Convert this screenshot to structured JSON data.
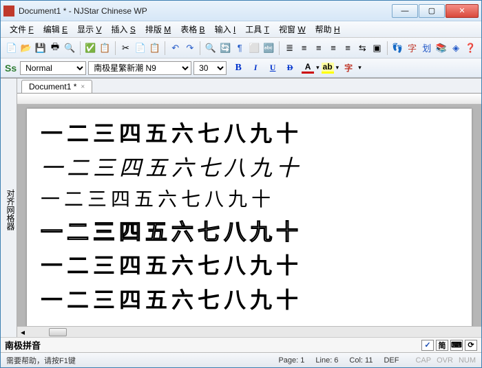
{
  "window": {
    "title": "Document1 * - NJStar Chinese WP"
  },
  "menu": {
    "items": [
      {
        "label": "文件",
        "key": "F"
      },
      {
        "label": "编辑",
        "key": "E"
      },
      {
        "label": "显示",
        "key": "V"
      },
      {
        "label": "插入",
        "key": "S"
      },
      {
        "label": "排版",
        "key": "M"
      },
      {
        "label": "表格",
        "key": "B"
      },
      {
        "label": "输入",
        "key": "I"
      },
      {
        "label": "工具",
        "key": "T"
      },
      {
        "label": "视窗",
        "key": "W"
      },
      {
        "label": "帮助",
        "key": "H"
      }
    ]
  },
  "toolbar1": {
    "icons": [
      "📄",
      "📂",
      "💾",
      "🖶",
      "🔍",
      "✅",
      "📋",
      "✂",
      "📄",
      "📋",
      "↶",
      "↷",
      "🔍",
      "🔄",
      "¶",
      "⬜",
      "🔤",
      "≣",
      "≡",
      "≡",
      "≡",
      "≡",
      "⇆",
      "▣",
      "👣",
      "字",
      "划",
      "📚",
      "◈",
      "❓"
    ]
  },
  "format": {
    "style_label": "Normal",
    "font_label": "南极星繁新潮 N9",
    "size": "30",
    "ss": "Ss",
    "bold": "B",
    "italic": "I",
    "underline": "U",
    "strike": "D",
    "font_color": "A",
    "highlight": "ab",
    "more": "字"
  },
  "sidebar": {
    "label": "对齐网格器"
  },
  "tabs": {
    "doc_tab": "Document1 *"
  },
  "document": {
    "lines": [
      "一二三四五六七八九十",
      "一二三四五六七八九十",
      "一二三四五六七八九十",
      "一二三四五六七八九十",
      "一二三四五六七八九十",
      "一二三四五六七八九十"
    ]
  },
  "ime": {
    "label": "南极拼音",
    "btns": [
      "✓",
      "简",
      "⌨",
      "⟳"
    ]
  },
  "status": {
    "help": "需要帮助，请按F1键",
    "page": "Page: 1",
    "line": "Line: 6",
    "col": "Col: 11",
    "def": "DEF",
    "cap": "CAP",
    "ovr": "OVR",
    "num": "NUM"
  }
}
